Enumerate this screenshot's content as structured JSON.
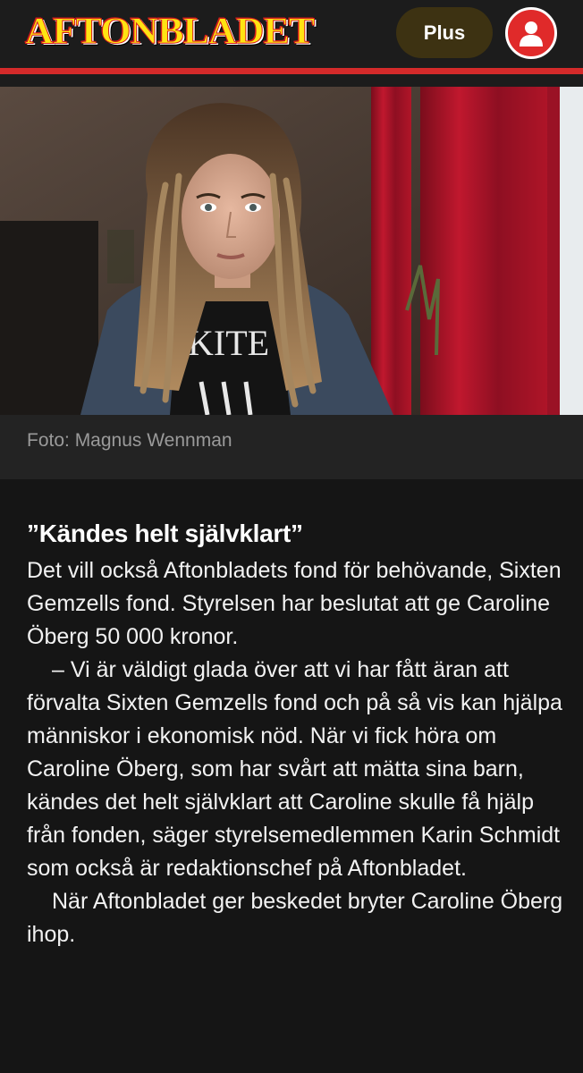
{
  "header": {
    "logo_text": "AFTONBLADET",
    "plus_label": "Plus",
    "account_icon": "user-icon",
    "accent_color": "#d42a2a",
    "logo_color": "#ffe312"
  },
  "hero": {
    "caption": "Foto: Magnus Wennman",
    "shirt_text": "KITE"
  },
  "article": {
    "subheading": "”Kändes helt självklart”",
    "paragraphs": [
      "Det vill också Aftonbladets fond för behövande, Sixten Gemzells fond. Styrelsen har beslutat att ge Caroline Öberg 50 000 kronor.",
      "– Vi är väldigt glada över att vi har fått äran att förvalta Sixten Gemzells fond och på så vis kan hjälpa människor i ekonomisk nöd. När vi fick höra om Caroline Öberg, som har svårt att mätta sina barn, kändes det helt självklart att Caroline skulle få hjälp från fonden, säger styrelsemedlemmen Karin Schmidt som också är redaktionschef på Aftonbladet.",
      "När Aftonbladet ger beskedet bryter Caroline Öberg ihop."
    ]
  }
}
